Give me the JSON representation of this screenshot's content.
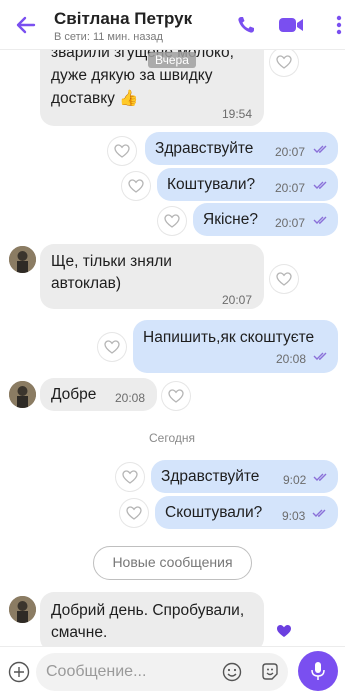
{
  "header": {
    "title": "Світлана Петрук",
    "subtitle": "В сети: 11 мин. назад"
  },
  "sticky_day": "Вчера",
  "messages": [
    {
      "dir": "in",
      "text_line1": "зварили згущене молоко,",
      "text_line2": "дуже дякую за швидку",
      "text_line3": "доставку 👍",
      "time": "19:54"
    },
    {
      "dir": "out",
      "text": "Здравствуйте",
      "time": "20:07"
    },
    {
      "dir": "out",
      "text": "Коштували?",
      "time": "20:07"
    },
    {
      "dir": "out",
      "text": "Якісне?",
      "time": "20:07"
    },
    {
      "dir": "in",
      "text_line1": "Ще, тільки зняли",
      "text_line2": "автоклав)",
      "time": "20:07"
    },
    {
      "dir": "out",
      "text": "Напишить,як скоштуєте",
      "time": "20:08"
    },
    {
      "dir": "in",
      "text": "Добре",
      "time": "20:08"
    },
    {
      "dir": "out",
      "text": "Здравствуйте",
      "time": "9:02"
    },
    {
      "dir": "out",
      "text": "Скоштували?",
      "time": "9:03"
    },
    {
      "dir": "in",
      "text_line1": "Добрий день. Спробували,",
      "text_line2": "смачне.",
      "time": ""
    }
  ],
  "day_separator": "Сегодня",
  "new_messages_label": "Новые сообщения",
  "composer": {
    "placeholder": "Сообщение..."
  },
  "colors": {
    "accent": "#7a4ff0",
    "incoming_bubble": "#ececec",
    "outgoing_bubble": "#d4e4fb"
  }
}
